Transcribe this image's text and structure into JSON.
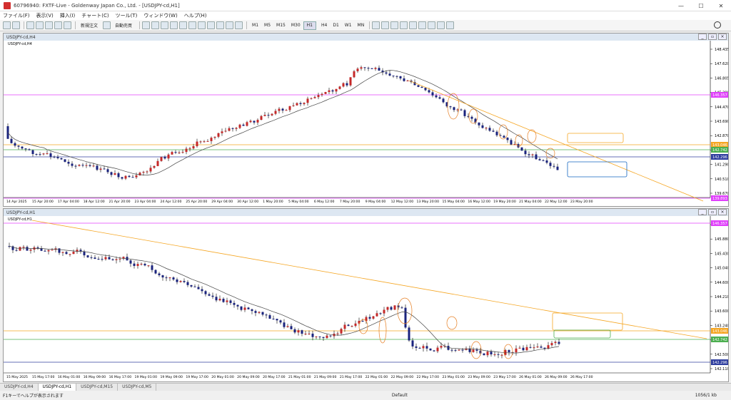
{
  "window": {
    "title": "60796940: FXTF-Live - Goldenway Japan Co., Ltd. - [USDJPY-cd,H1]"
  },
  "menu": [
    "ファイル(F)",
    "表示(V)",
    "挿入(I)",
    "チャート(C)",
    "ツール(T)",
    "ウィンドウ(W)",
    "ヘルプ(H)"
  ],
  "toolbar": {
    "new_order": "新規注文",
    "auto_trade": "自動売買",
    "timeframes": [
      "M1",
      "M5",
      "M15",
      "M30",
      "H1",
      "H4",
      "D1",
      "W1",
      "MN"
    ],
    "active_tf": "H1"
  },
  "chart_top": {
    "window_title": "USDJPY-cd,H4",
    "label": "USDJPY-cd,H4",
    "y_ticks": [
      "148.435",
      "147.620",
      "146.805",
      "145.290",
      "144.470",
      "143.690",
      "142.870",
      "142.110",
      "141.290",
      "140.510",
      "139.670"
    ],
    "x_ticks": [
      "14 Apr 2025",
      "15 Apr 20:00",
      "17 Apr 04:00",
      "18 Apr 12:00",
      "21 Apr 20:00",
      "23 Apr 04:00",
      "24 Apr 12:00",
      "25 Apr 20:00",
      "29 Apr 04:00",
      "30 Apr 12:00",
      "1 May 20:00",
      "5 May 04:00",
      "6 May 12:00",
      "7 May 20:00",
      "9 May 04:00",
      "12 May 12:00",
      "13 May 20:00",
      "15 May 04:00",
      "16 May 12:00",
      "19 May 20:00",
      "21 May 04:00",
      "22 May 12:00",
      "23 May 20:00"
    ],
    "price_tags": {
      "magenta": "146.357",
      "orange": "143.046",
      "green": "142.742",
      "blue": "142.296",
      "bottom": "139.893"
    }
  },
  "chart_bottom": {
    "window_title": "USDJPY-cd,H1",
    "label": "USDJPY-cd,H1",
    "y_ticks": [
      "146.165",
      "145.880",
      "145.430",
      "145.040",
      "144.600",
      "144.210",
      "143.600",
      "143.240",
      "142.880",
      "142.500",
      "142.110"
    ],
    "x_ticks": [
      "15 May 2025",
      "15 May 17:00",
      "16 May 01:00",
      "16 May 09:00",
      "16 May 17:00",
      "19 May 01:00",
      "19 May 09:00",
      "19 May 17:00",
      "20 May 01:00",
      "20 May 09:00",
      "20 May 17:00",
      "21 May 01:00",
      "21 May 09:00",
      "21 May 17:00",
      "22 May 01:00",
      "22 May 09:00",
      "22 May 17:00",
      "23 May 01:00",
      "23 May 09:00",
      "23 May 17:00",
      "26 May 01:00",
      "26 May 09:00",
      "26 May 17:00"
    ],
    "price_tags": {
      "magenta": "146.357",
      "orange": "143.046",
      "green": "142.742",
      "blue": "142.296"
    }
  },
  "tabs": [
    "USDJPY-cd,H4",
    "USDJPY-cd,H1",
    "USDJPY-cd,M15",
    "USDJPY-cd,M5"
  ],
  "active_tab": "USDJPY-cd,H1",
  "status": {
    "help": "F1キーでヘルプが表示されます",
    "profile": "Default",
    "traffic": "1056/1 kb"
  }
}
